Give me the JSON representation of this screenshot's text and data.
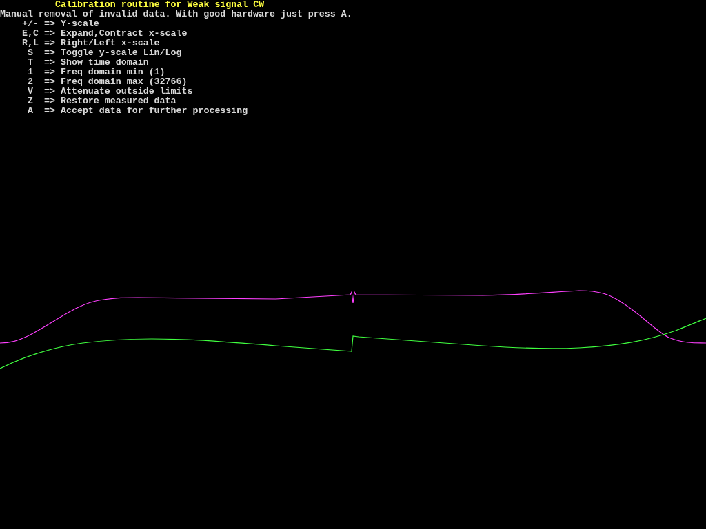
{
  "title": "Calibration routine for Weak signal CW",
  "instruction": "Manual removal of invalid data. With good hardware just press A.",
  "keys": [
    {
      "key": "+/-",
      "arrow": "=>",
      "action": "Y-scale"
    },
    {
      "key": "E,C",
      "arrow": "=>",
      "action": "Expand,Contract x-scale"
    },
    {
      "key": "R,L",
      "arrow": "=>",
      "action": "Right/Left x-scale"
    },
    {
      "key": "S",
      "arrow": "=>",
      "action": "Toggle y-scale Lin/Log"
    },
    {
      "key": "T",
      "arrow": "=>",
      "action": "Show time domain"
    },
    {
      "key": "1",
      "arrow": "=>",
      "action": "Freq domain min (1)"
    },
    {
      "key": "2",
      "arrow": "=>",
      "action": "Freq domain max (32766)"
    },
    {
      "key": "V",
      "arrow": "=>",
      "action": "Attenuate outside limits"
    },
    {
      "key": "Z",
      "arrow": "=>",
      "action": "Restore measured data"
    },
    {
      "key": "A",
      "arrow": "=>",
      "action": "Accept data for further processing"
    }
  ]
}
